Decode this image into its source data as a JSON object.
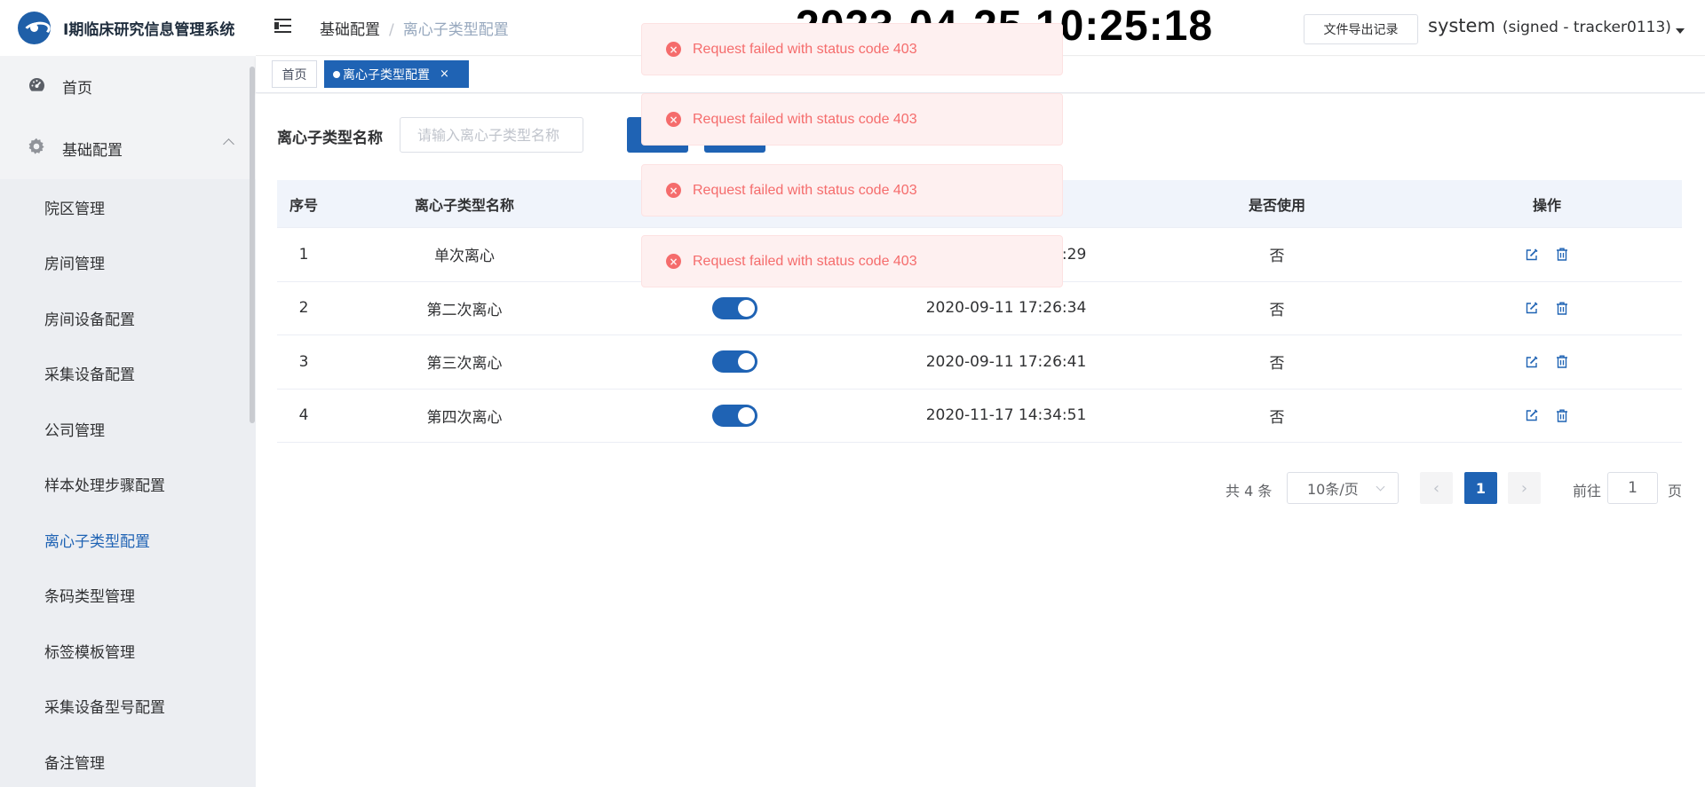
{
  "app": {
    "title": "I期临床研究信息管理系统"
  },
  "sidebar": {
    "home": {
      "label": "首页",
      "icon": "dashboard-icon"
    },
    "group": {
      "label": "基础配置",
      "icon": "gear-icon",
      "expanded": true
    },
    "items": [
      {
        "label": "院区管理"
      },
      {
        "label": "房间管理"
      },
      {
        "label": "房间设备配置"
      },
      {
        "label": "采集设备配置"
      },
      {
        "label": "公司管理"
      },
      {
        "label": "样本处理步骤配置"
      },
      {
        "label": "离心子类型配置",
        "active": true
      },
      {
        "label": "条码类型管理"
      },
      {
        "label": "标签模板管理"
      },
      {
        "label": "采集设备型号配置"
      },
      {
        "label": "备注管理"
      }
    ]
  },
  "header": {
    "breadcrumb": {
      "parent": "基础配置",
      "separator": "/",
      "current": "离心子类型配置"
    },
    "clock": "2023-04-25 10:25:18",
    "export_button": "文件导出记录",
    "user": {
      "name": "system",
      "signed": "(signed - tracker0113)"
    }
  },
  "tags": {
    "home": "首页",
    "current": "离心子类型配置",
    "close": "×"
  },
  "filter": {
    "label": "离心子类型名称",
    "placeholder": "请输入离心子类型名称",
    "value": ""
  },
  "table": {
    "headers": [
      "序号",
      "离心子类型名称",
      "",
      "",
      "是否使用",
      "操作"
    ],
    "rows": [
      {
        "index": "1",
        "name": "单次离心",
        "enabled": true,
        "time": "2020-09-11 17:26:29",
        "used": "否"
      },
      {
        "index": "2",
        "name": "第二次离心",
        "enabled": true,
        "time": "2020-09-11 17:26:34",
        "used": "否"
      },
      {
        "index": "3",
        "name": "第三次离心",
        "enabled": true,
        "time": "2020-09-11 17:26:41",
        "used": "否"
      },
      {
        "index": "4",
        "name": "第四次离心",
        "enabled": true,
        "time": "2020-11-17 14:34:51",
        "used": "否"
      }
    ]
  },
  "pagination": {
    "total": "共 4 条",
    "page_size": "10条/页",
    "current_page": "1",
    "goto_label": "前往",
    "goto_value": "1",
    "page_suffix": "页"
  },
  "toasts": [
    {
      "message": "Request failed with status code 403"
    },
    {
      "message": "Request failed with status code 403"
    },
    {
      "message": "Request failed with status code 403"
    },
    {
      "message": "Request failed with status code 403"
    }
  ],
  "colors": {
    "primary": "#1f63b4",
    "error": "#f56c6c",
    "error_bg": "#fef0f0",
    "sidebar_bg": "#f2f3f5"
  }
}
